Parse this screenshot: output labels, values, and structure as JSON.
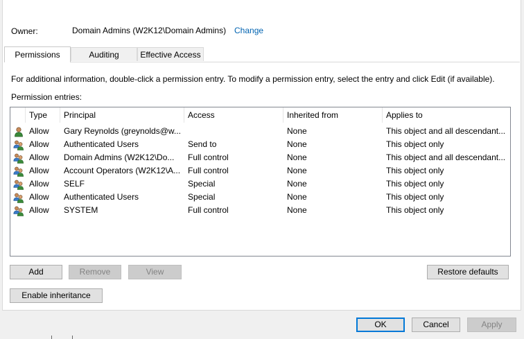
{
  "owner": {
    "label": "Owner:",
    "value": "Domain Admins (W2K12\\Domain Admins)",
    "change_link": "Change"
  },
  "tabs": [
    {
      "label": "Permissions",
      "active": true
    },
    {
      "label": "Auditing",
      "active": false
    },
    {
      "label": "Effective Access",
      "active": false
    }
  ],
  "info_text": "For additional information, double-click a permission entry. To modify a permission entry, select the entry and click Edit (if available).",
  "entries_label": "Permission entries:",
  "columns": [
    "Type",
    "Principal",
    "Access",
    "Inherited from",
    "Applies to"
  ],
  "rows": [
    {
      "icon": "single-user-icon",
      "type": "Allow",
      "principal": "Gary Reynolds (greynolds@w...",
      "access": "",
      "inherited": "None",
      "applies": "This object and all descendant..."
    },
    {
      "icon": "user-group-icon",
      "type": "Allow",
      "principal": "Authenticated Users",
      "access": "Send to",
      "inherited": "None",
      "applies": "This object only"
    },
    {
      "icon": "user-group-icon",
      "type": "Allow",
      "principal": "Domain Admins (W2K12\\Do...",
      "access": "Full control",
      "inherited": "None",
      "applies": "This object and all descendant..."
    },
    {
      "icon": "user-group-icon",
      "type": "Allow",
      "principal": "Account Operators (W2K12\\A...",
      "access": "Full control",
      "inherited": "None",
      "applies": "This object only"
    },
    {
      "icon": "user-group-icon",
      "type": "Allow",
      "principal": "SELF",
      "access": "Special",
      "inherited": "None",
      "applies": "This object only"
    },
    {
      "icon": "user-group-icon",
      "type": "Allow",
      "principal": "Authenticated Users",
      "access": "Special",
      "inherited": "None",
      "applies": "This object only"
    },
    {
      "icon": "user-group-icon",
      "type": "Allow",
      "principal": "SYSTEM",
      "access": "Full control",
      "inherited": "None",
      "applies": "This object only"
    }
  ],
  "buttons": {
    "add": "Add",
    "remove": "Remove",
    "view": "View",
    "restore": "Restore defaults",
    "enable_inheritance": "Enable inheritance",
    "ok": "OK",
    "cancel": "Cancel",
    "apply": "Apply"
  },
  "colors": {
    "link": "#0063b1",
    "accent": "#0078d7"
  }
}
